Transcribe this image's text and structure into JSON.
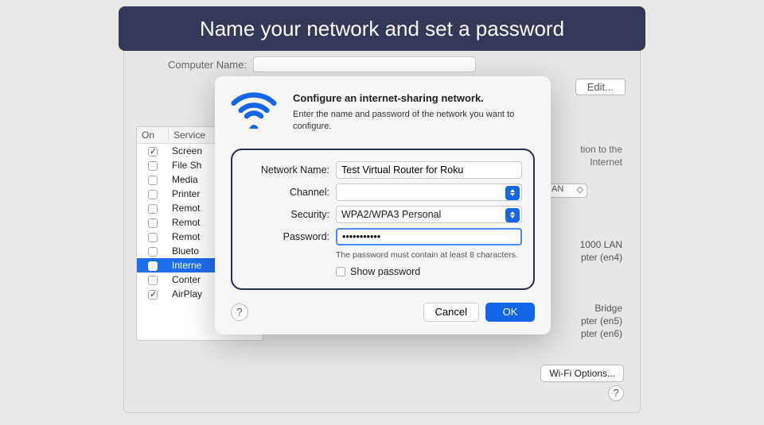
{
  "banner": {
    "text": "Name your network and set a password"
  },
  "background": {
    "computer_name_label": "Computer Name:",
    "edit_label": "Edit...",
    "services": {
      "head_on": "On",
      "head_service": "Service",
      "items": [
        {
          "on": true,
          "label": "Screen"
        },
        {
          "on": false,
          "label": "File Sh"
        },
        {
          "on": false,
          "label": "Media"
        },
        {
          "on": false,
          "label": "Printer"
        },
        {
          "on": false,
          "label": "Remot"
        },
        {
          "on": false,
          "label": "Remot"
        },
        {
          "on": false,
          "label": "Remot"
        },
        {
          "on": false,
          "label": "Blueto"
        },
        {
          "on": false,
          "label": "Interne",
          "selected": true
        },
        {
          "on": false,
          "label": "Conter"
        },
        {
          "on": true,
          "label": "AirPlay"
        }
      ]
    },
    "right_hint_1": "tion to the",
    "right_hint_2": "Internet",
    "lan_label": "AN",
    "port_1": "1000 LAN",
    "port_1b": "pter (en4)",
    "port_2": "Bridge",
    "port_2b": "pter (en5)",
    "port_2c": "pter (en6)",
    "wifi_options_label": "Wi-Fi Options..."
  },
  "modal": {
    "title": "Configure an internet-sharing network.",
    "subtitle": "Enter the name and password of the network you want to configure.",
    "labels": {
      "network_name": "Network Name:",
      "channel": "Channel:",
      "security": "Security:",
      "password": "Password:"
    },
    "values": {
      "network_name": "Test Virtual Router for Roku",
      "channel": "",
      "security": "WPA2/WPA3 Personal",
      "password": "•••••••••••"
    },
    "helper": "The password must contain at least 8 characters.",
    "show_password_label": "Show password",
    "buttons": {
      "cancel": "Cancel",
      "ok": "OK"
    },
    "help": "?"
  }
}
